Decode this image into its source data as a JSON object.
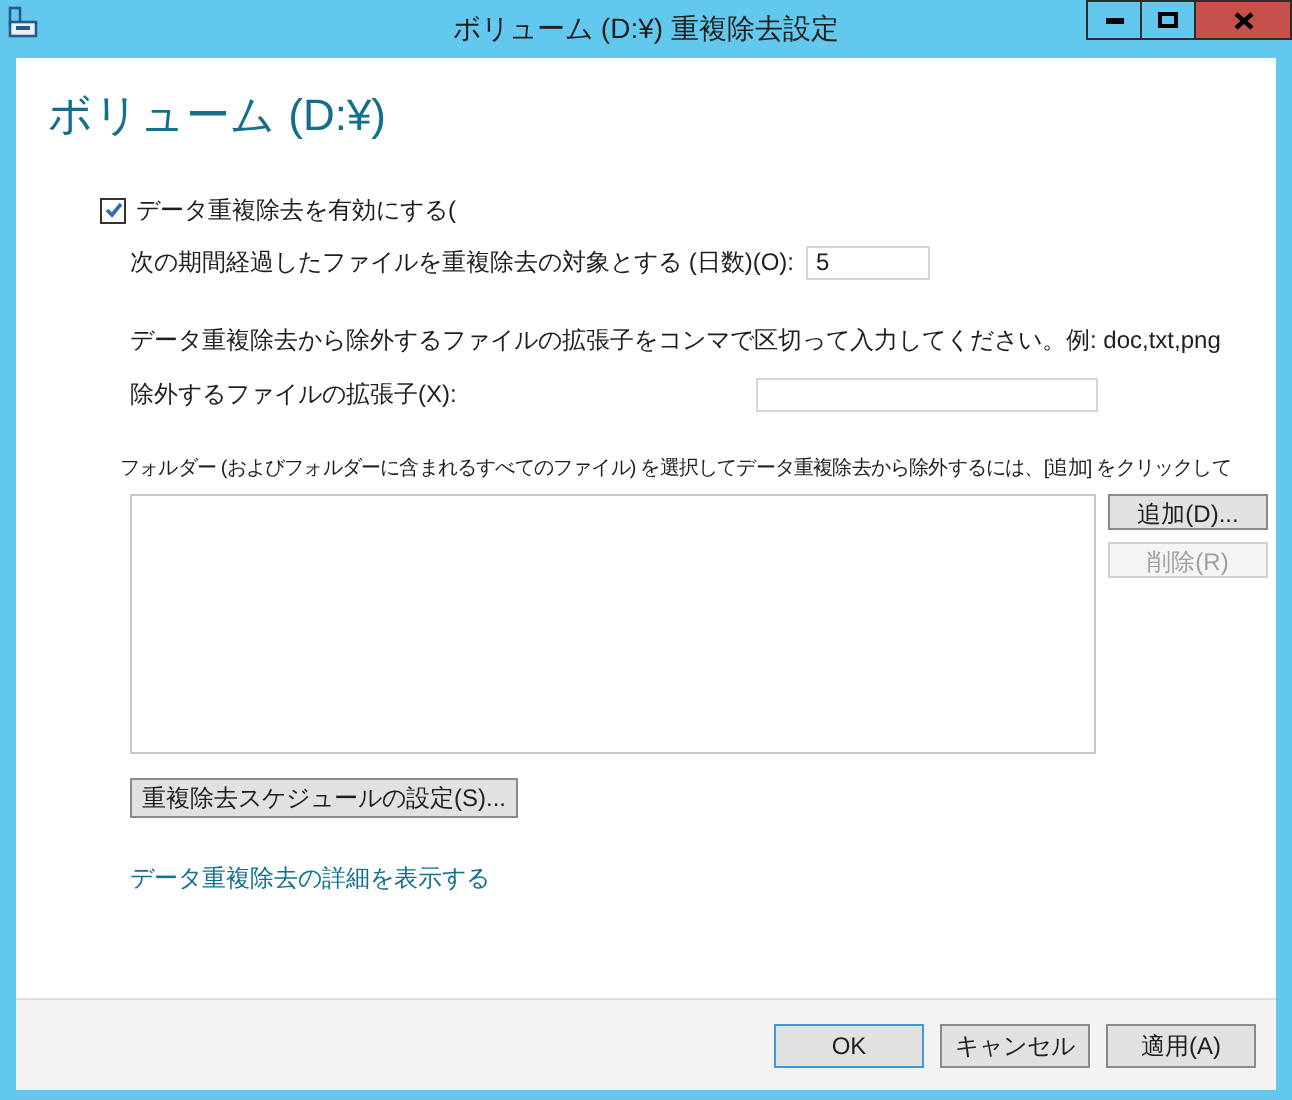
{
  "window": {
    "title": "ボリューム (D:¥) 重複除去設定"
  },
  "heading": "ボリューム (D:¥)",
  "enable_checkbox": {
    "label": "データ重複除去を有効にする(",
    "checked": true
  },
  "age_field": {
    "label": "次の期間経過したファイルを重複除去の対象とする (日数)(O):",
    "value": "5"
  },
  "extensions_hint": "データ重複除去から除外するファイルの拡張子をコンマで区切って入力してください。例: doc,txt,png",
  "extensions_field": {
    "label": "除外するファイルの拡張子(X):"
  },
  "folders_hint": "フォルダー (およびフォルダーに含まれるすべてのファイル) を選択してデータ重複除去から除外するには、[追加] をクリックして",
  "folder_buttons": [
    {
      "label": "追加(D)...",
      "disabled": false
    },
    {
      "label": "削除(R)",
      "disabled": true
    }
  ],
  "schedule_button": "重複除去スケジュールの設定(S)...",
  "details_link": "データ重複除去の詳細を表示する",
  "footer_buttons": [
    {
      "label": "OK",
      "default": true
    },
    {
      "label": "キャンセル",
      "default": false
    },
    {
      "label": "適用(A)",
      "default": false
    }
  ]
}
